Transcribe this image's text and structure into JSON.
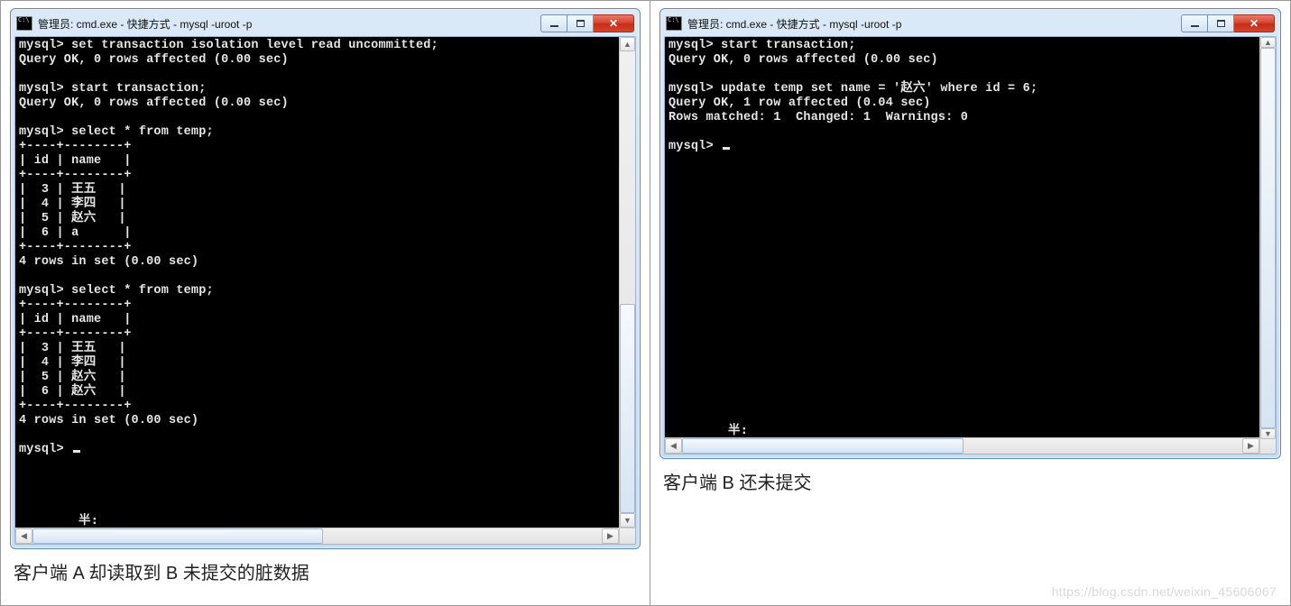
{
  "left": {
    "title": "管理员: cmd.exe - 快捷方式 - mysql  -uroot -p",
    "lines": [
      "mysql> set transaction isolation level read uncommitted;",
      "Query OK, 0 rows affected (0.00 sec)",
      "",
      "mysql> start transaction;",
      "Query OK, 0 rows affected (0.00 sec)",
      "",
      "mysql> select * from temp;",
      "+----+--------+",
      "| id | name   |",
      "+----+--------+",
      "|  3 | 王五   |",
      "|  4 | 李四   |",
      "|  5 | 赵六   |",
      "|  6 | a      |",
      "+----+--------+",
      "4 rows in set (0.00 sec)",
      "",
      "mysql> select * from temp;",
      "+----+--------+",
      "| id | name   |",
      "+----+--------+",
      "|  3 | 王五   |",
      "|  4 | 李四   |",
      "|  5 | 赵六   |",
      "|  6 | 赵六   |",
      "+----+--------+",
      "4 rows in set (0.00 sec)",
      "",
      "mysql> "
    ],
    "status": "半:",
    "caption": "客户端 A 却读取到 B 未提交的脏数据"
  },
  "right": {
    "title": "管理员: cmd.exe - 快捷方式 - mysql  -uroot -p",
    "lines": [
      "mysql> start transaction;",
      "Query OK, 0 rows affected (0.00 sec)",
      "",
      "mysql> update temp set name = '赵六' where id = 6;",
      "Query OK, 1 row affected (0.04 sec)",
      "Rows matched: 1  Changed: 1  Warnings: 0",
      "",
      "mysql> "
    ],
    "status": "半:",
    "caption": "客户端 B 还未提交"
  },
  "watermark": "https://blog.csdn.net/weixin_45606067"
}
